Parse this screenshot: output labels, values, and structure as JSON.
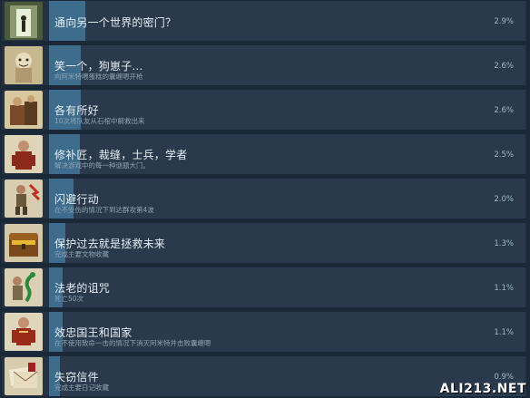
{
  "achievements": [
    {
      "title": "通向另一个世界的密门？",
      "description": "",
      "percent": "2.9%",
      "progress": 0.029,
      "icon": "secret-door-icon"
    },
    {
      "title": "笑一个，狗崽子…",
      "description": "向阿米特喂蛋糕的囊缠嗯开枪",
      "percent": "2.6%",
      "progress": 0.026,
      "icon": "laughing-mummy-icon"
    },
    {
      "title": "各有所好",
      "description": "10次将队友从石棺中解救出来",
      "percent": "2.6%",
      "progress": 0.026,
      "icon": "sarcophagus-icon"
    },
    {
      "title": "修补匠，裁缝，士兵，学者",
      "description": "解决游戏中的每一种谜题大门。",
      "percent": "2.5%",
      "progress": 0.025,
      "icon": "scholar-icon"
    },
    {
      "title": "闪避行动",
      "description": "在不受伤的情况下到达群攻第4波",
      "percent": "2.0%",
      "progress": 0.02,
      "icon": "dodging-explorer-icon"
    },
    {
      "title": "保护过去就是拯救未来",
      "description": "完成主要文物收藏",
      "percent": "1.3%",
      "progress": 0.013,
      "icon": "treasure-chest-icon"
    },
    {
      "title": "法老的诅咒",
      "description": "死亡50次",
      "percent": "1.1%",
      "progress": 0.011,
      "icon": "cursed-serpent-icon"
    },
    {
      "title": "效忠国王和国家",
      "description": "在不使用致命一击的情况下消灭阿米特并击败囊缠嗯",
      "percent": "1.1%",
      "progress": 0.011,
      "icon": "soldier-icon"
    },
    {
      "title": "失窃信件",
      "description": "完成主要日记收藏",
      "percent": "0.9%",
      "progress": 0.009,
      "icon": "letters-icon"
    }
  ],
  "watermark": "ALI213.NET",
  "colors": {
    "background": "#1b2838",
    "row": "#2a3a4c",
    "progress_fill": "#3d6c8d",
    "title": "#e6edf3",
    "description": "#8fa3b5",
    "percent": "#9fb7cc"
  }
}
